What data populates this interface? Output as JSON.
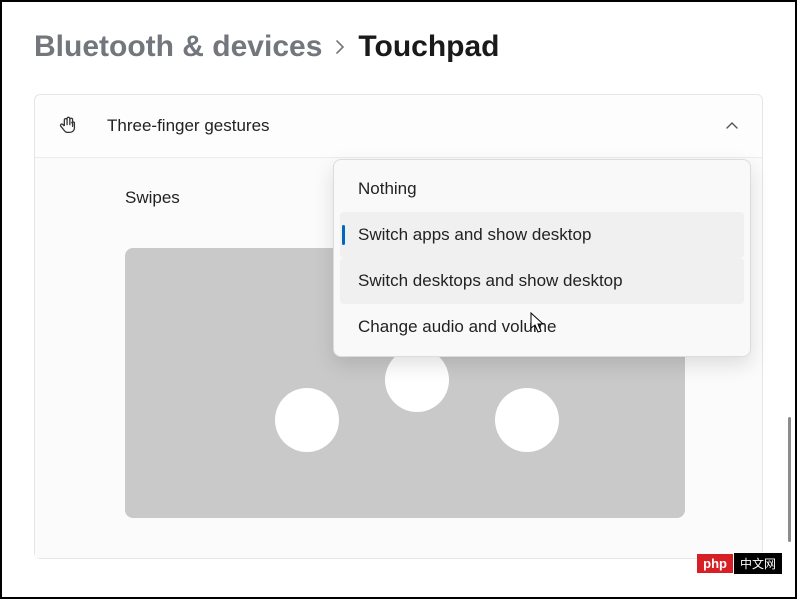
{
  "breadcrumb": {
    "parent": "Bluetooth & devices",
    "current": "Touchpad"
  },
  "section": {
    "title": "Three-finger gestures",
    "expanded": true
  },
  "swipes": {
    "label": "Swipes",
    "options": [
      {
        "label": "Nothing",
        "selected": false,
        "hovered": false
      },
      {
        "label": "Switch apps and show desktop",
        "selected": true,
        "hovered": false
      },
      {
        "label": "Switch desktops and show desktop",
        "selected": false,
        "hovered": true
      },
      {
        "label": "Change audio and volume",
        "selected": false,
        "hovered": false
      }
    ]
  },
  "watermark": {
    "left": "php",
    "right": "中文网"
  }
}
